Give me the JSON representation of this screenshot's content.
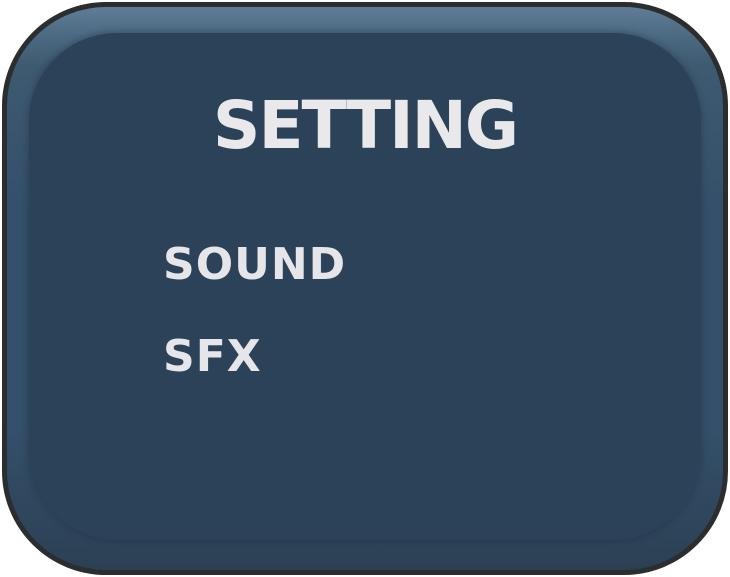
{
  "dialog": {
    "title": "SETTING",
    "options": [
      {
        "label": "SOUND"
      },
      {
        "label": "SFX"
      }
    ]
  },
  "colors": {
    "panel_border": "#2b2d2f",
    "panel_fill": "#2c4258",
    "panel_highlight": "#5f7d96",
    "text": "#e9e9ec"
  }
}
